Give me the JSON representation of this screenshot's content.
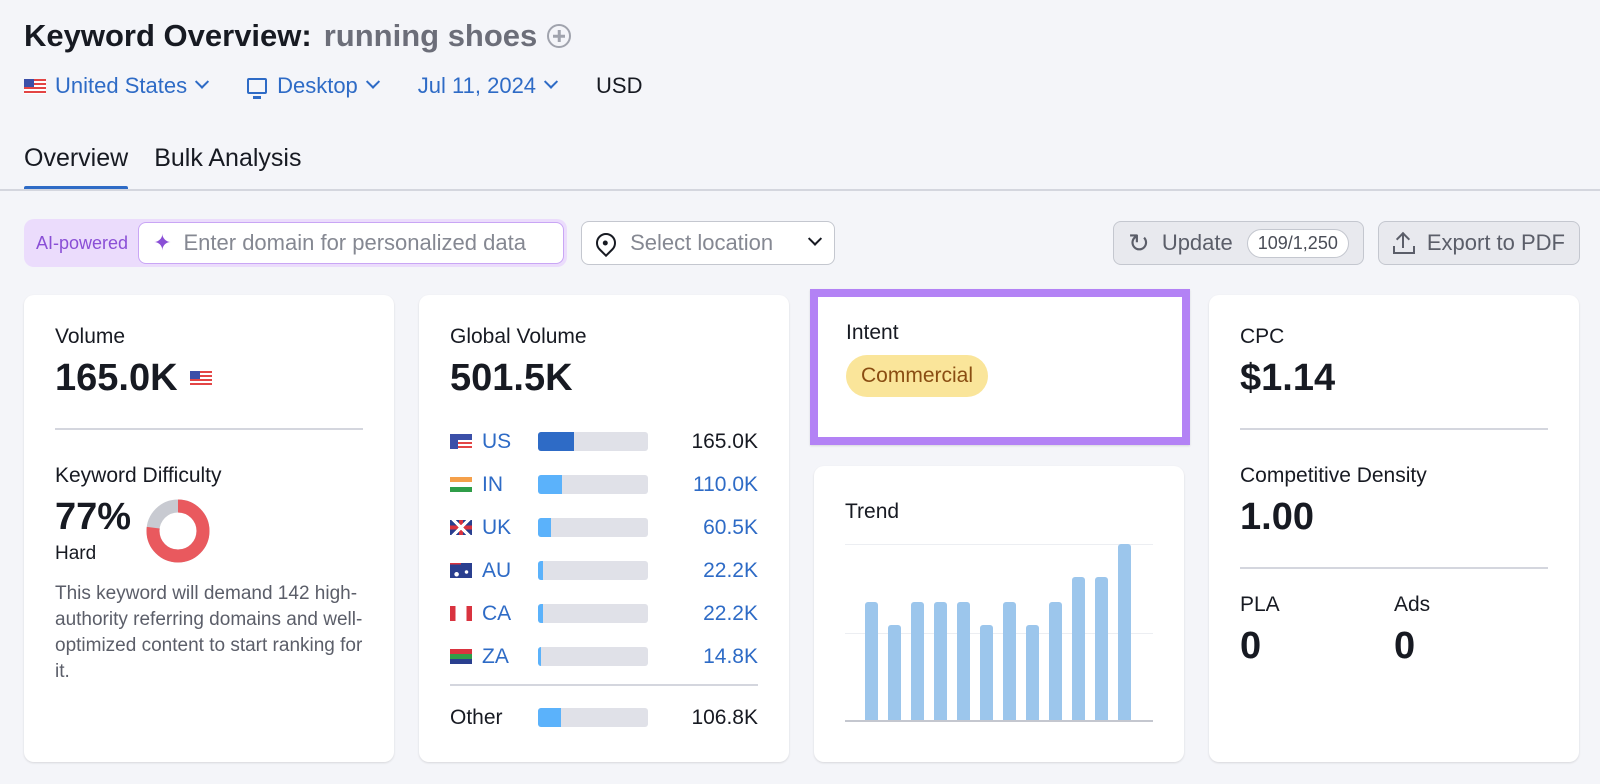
{
  "header": {
    "title": "Keyword Overview:",
    "keyword": "running shoes",
    "filters": {
      "country": "United States",
      "device": "Desktop",
      "date": "Jul 11, 2024",
      "currency": "USD"
    }
  },
  "tabs": [
    {
      "label": "Overview",
      "active": true
    },
    {
      "label": "Bulk Analysis",
      "active": false
    }
  ],
  "toolbar": {
    "ai_label": "AI-powered",
    "domain_placeholder": "Enter domain for personalized data",
    "location_placeholder": "Select location",
    "update_label": "Update",
    "update_counter": "109/1,250",
    "export_label": "Export to PDF"
  },
  "volume": {
    "label": "Volume",
    "value": "165.0K",
    "kd_label": "Keyword Difficulty",
    "kd_value": "77%",
    "kd_percent": 77,
    "kd_level": "Hard",
    "kd_description": "This keyword will demand 142 high-authority referring domains and well-optimized content to start ranking for it.",
    "colors": {
      "kd_fill": "#e9595e",
      "kd_track": "#c8cad1"
    }
  },
  "global_volume": {
    "label": "Global Volume",
    "value": "501.5K",
    "countries": [
      {
        "code": "US",
        "value": "165.0K",
        "share": 0.33,
        "highlight": true
      },
      {
        "code": "IN",
        "value": "110.0K",
        "share": 0.22,
        "highlight": false
      },
      {
        "code": "UK",
        "value": "60.5K",
        "share": 0.12,
        "highlight": false
      },
      {
        "code": "AU",
        "value": "22.2K",
        "share": 0.044,
        "highlight": false
      },
      {
        "code": "CA",
        "value": "22.2K",
        "share": 0.044,
        "highlight": false
      },
      {
        "code": "ZA",
        "value": "14.8K",
        "share": 0.03,
        "highlight": false
      }
    ],
    "other": {
      "label": "Other",
      "value": "106.8K",
      "share": 0.21
    }
  },
  "intent": {
    "label": "Intent",
    "value": "Commercial"
  },
  "trend": {
    "label": "Trend",
    "values": [
      0.67,
      0.54,
      0.67,
      0.67,
      0.67,
      0.54,
      0.67,
      0.54,
      0.67,
      0.81,
      0.81,
      1.0
    ]
  },
  "cpc": {
    "label": "CPC",
    "value": "$1.14",
    "density_label": "Competitive Density",
    "density_value": "1.00",
    "pla_label": "PLA",
    "pla_value": "0",
    "ads_label": "Ads",
    "ads_value": "0"
  }
}
